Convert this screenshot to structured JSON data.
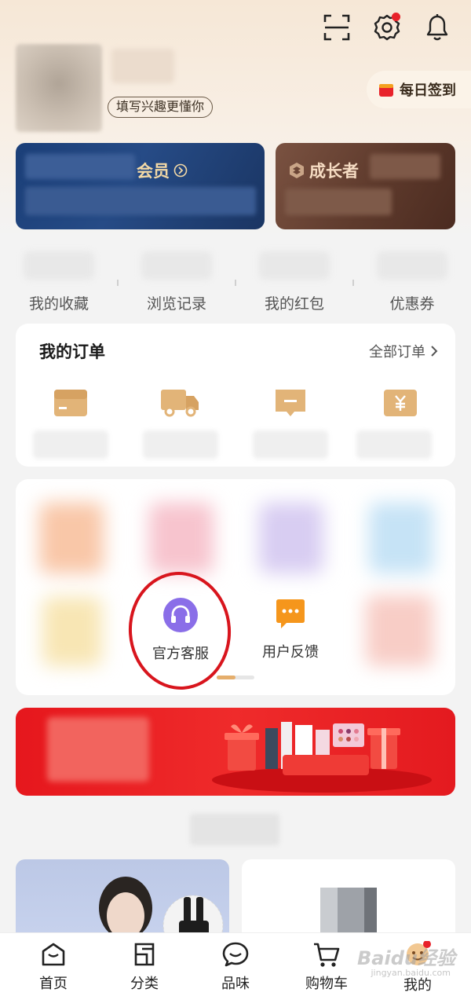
{
  "header": {
    "interest_label": "填写兴趣更懂你",
    "checkin_label": "每日签到"
  },
  "cards": {
    "vip_title": "会员",
    "growth_title": "成长者"
  },
  "quick_links": [
    {
      "label": "我的收藏"
    },
    {
      "label": "浏览记录"
    },
    {
      "label": "我的红包"
    },
    {
      "label": "优惠券"
    }
  ],
  "orders": {
    "title": "我的订单",
    "all_label": "全部订单"
  },
  "services": {
    "items": [
      {
        "label": "官方客服",
        "icon": "headset-icon"
      },
      {
        "label": "用户反馈",
        "icon": "chat-bubble-icon"
      }
    ]
  },
  "tabbar": [
    {
      "label": "首页",
      "icon": "home-icon"
    },
    {
      "label": "分类",
      "icon": "category-icon"
    },
    {
      "label": "品味",
      "icon": "taste-icon"
    },
    {
      "label": "购物车",
      "icon": "cart-icon"
    },
    {
      "label": "我的",
      "icon": "profile-icon"
    }
  ],
  "watermark": {
    "main": "Baidu经验",
    "sub": "jingyan.baidu.com"
  },
  "colors": {
    "accent_red": "#e8222a",
    "gold": "#e5ae6c",
    "vip_blue": "#1b3f78",
    "growth_brown": "#5e3a2c"
  }
}
